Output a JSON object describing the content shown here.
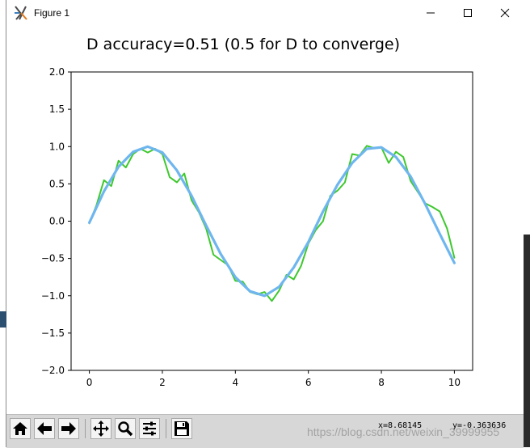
{
  "window": {
    "title": "Figure 1"
  },
  "toolbar": {
    "buttons": [
      "home-icon",
      "back-arrow-icon",
      "forward-arrow-icon",
      "pan-icon",
      "zoom-icon",
      "configure-subplots-icon",
      "save-icon"
    ],
    "coord_x": "x=8.68145",
    "coord_y": "y=-0.363636"
  },
  "watermark": "https://blog.csdn.net/weixin_39999955",
  "colors": {
    "real_line": "#3ec82e",
    "generated_line": "#6fb6ef",
    "toolbar_bg": "#d7d7d7"
  },
  "chart_data": {
    "type": "line",
    "title": "D accuracy=0.51 (0.5 for D to converge)",
    "xlabel": "",
    "ylabel": "",
    "xlim": [
      -0.5,
      10.5
    ],
    "ylim": [
      -2.0,
      2.0
    ],
    "xticks": [
      0,
      2,
      4,
      6,
      8,
      10
    ],
    "yticks": [
      -2.0,
      -1.5,
      -1.0,
      -0.5,
      0.0,
      0.5,
      1.0,
      1.5,
      2.0
    ],
    "xtick_labels": [
      "0",
      "2",
      "4",
      "6",
      "8",
      "10"
    ],
    "ytick_labels": [
      "−2.0",
      "−1.5",
      "−1.0",
      "−0.5",
      "0.0",
      "0.5",
      "1.0",
      "1.5",
      "2.0"
    ],
    "grid": false,
    "series": [
      {
        "key": "real",
        "color": "#3ec82e",
        "width": 2,
        "x": [
          0.0,
          0.2,
          0.4,
          0.6,
          0.8,
          1.0,
          1.2,
          1.4,
          1.6,
          1.8,
          2.0,
          2.2,
          2.4,
          2.6,
          2.8,
          3.0,
          3.2,
          3.4,
          3.6,
          3.8,
          4.0,
          4.2,
          4.4,
          4.6,
          4.8,
          5.0,
          5.2,
          5.4,
          5.6,
          5.8,
          6.0,
          6.2,
          6.4,
          6.6,
          6.8,
          7.0,
          7.2,
          7.4,
          7.6,
          7.8,
          8.0,
          8.2,
          8.4,
          8.6,
          8.8,
          9.0,
          9.2,
          9.4,
          9.6,
          9.8,
          10.0
        ],
        "y": [
          -0.03,
          0.22,
          0.55,
          0.47,
          0.81,
          0.72,
          0.9,
          0.97,
          0.92,
          0.97,
          0.9,
          0.59,
          0.52,
          0.64,
          0.28,
          0.12,
          -0.1,
          -0.45,
          -0.52,
          -0.59,
          -0.8,
          -0.81,
          -0.95,
          -0.98,
          -0.95,
          -1.07,
          -0.93,
          -0.72,
          -0.78,
          -0.6,
          -0.3,
          -0.12,
          0.0,
          0.34,
          0.41,
          0.52,
          0.9,
          0.88,
          1.01,
          0.98,
          0.99,
          0.78,
          0.93,
          0.86,
          0.54,
          0.39,
          0.24,
          0.19,
          0.13,
          -0.1,
          -0.49
        ]
      },
      {
        "key": "generated",
        "color": "#6fb6ef",
        "width": 3.2,
        "x": [
          0.0,
          0.4,
          0.8,
          1.2,
          1.6,
          2.0,
          2.4,
          2.8,
          3.2,
          3.6,
          4.0,
          4.4,
          4.8,
          5.2,
          5.6,
          6.0,
          6.4,
          6.8,
          7.2,
          7.6,
          8.0,
          8.4,
          8.8,
          9.2,
          9.6,
          10.0
        ],
        "y": [
          -0.02,
          0.4,
          0.73,
          0.93,
          1.0,
          0.92,
          0.68,
          0.34,
          -0.06,
          -0.44,
          -0.75,
          -0.94,
          -1.0,
          -0.88,
          -0.62,
          -0.28,
          0.13,
          0.49,
          0.78,
          0.97,
          0.99,
          0.86,
          0.6,
          0.23,
          -0.17,
          -0.56
        ]
      }
    ]
  }
}
